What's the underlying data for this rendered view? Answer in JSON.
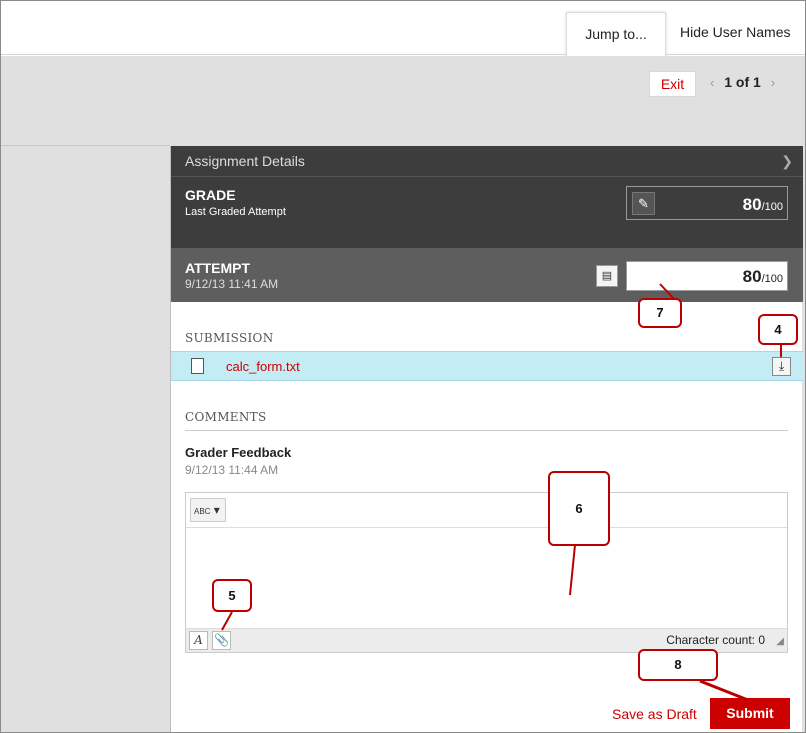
{
  "topbar": {
    "jump_label": "Jump to...",
    "hide_names_label": "Hide User Names"
  },
  "nav": {
    "exit_label": "Exit",
    "prev_icon": "‹",
    "page_count": "1 of 1",
    "next_icon": "›"
  },
  "details": {
    "header": "Assignment Details"
  },
  "grade": {
    "title": "GRADE",
    "subtitle": "Last Graded Attempt",
    "value": "80",
    "max": "/100"
  },
  "attempt": {
    "title": "ATTEMPT",
    "date": "9/12/13 11:41 AM",
    "value": "80",
    "max": "/100"
  },
  "submission": {
    "label": "SUBMISSION",
    "file_name": "calc_form.txt"
  },
  "comments": {
    "label": "COMMENTS",
    "feedback_title": "Grader Feedback",
    "feedback_date": "9/12/13 11:44 AM",
    "spell_label": "ABC",
    "char_count": "Character count: 0"
  },
  "actions": {
    "save_draft_label": "Save as Draft",
    "submit_label": "Submit"
  },
  "callouts": {
    "c4": "4",
    "c5": "5",
    "c6": "6",
    "c7": "7",
    "c8": "8"
  },
  "colors": {
    "accent": "#cc0000",
    "dark_panel": "#3d3d3d",
    "attempt_panel": "#5e5e5e",
    "file_row": "#c4ecf5"
  }
}
